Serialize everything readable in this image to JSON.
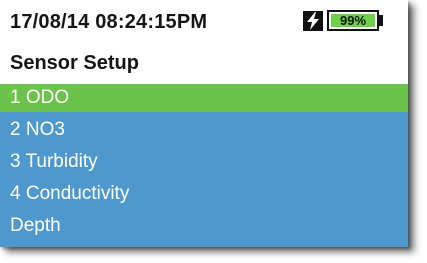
{
  "status_bar": {
    "datetime": "17/08/14  08:24:15PM",
    "battery_level": 0.99,
    "battery_text": "99%",
    "charging_icon": "lightning-bolt-icon"
  },
  "screen": {
    "title": "Sensor Setup"
  },
  "menu": {
    "items": [
      {
        "label": "1 ODO",
        "selected": true
      },
      {
        "label": "2 NO3",
        "selected": false
      },
      {
        "label": "3 Turbidity",
        "selected": false
      },
      {
        "label": "4 Conductivity",
        "selected": false
      },
      {
        "label": "Depth",
        "selected": false
      }
    ]
  },
  "colors": {
    "menu_background": "#4f98cd",
    "selected_highlight": "#6cc34b",
    "battery_fill": "#6dd04a"
  }
}
